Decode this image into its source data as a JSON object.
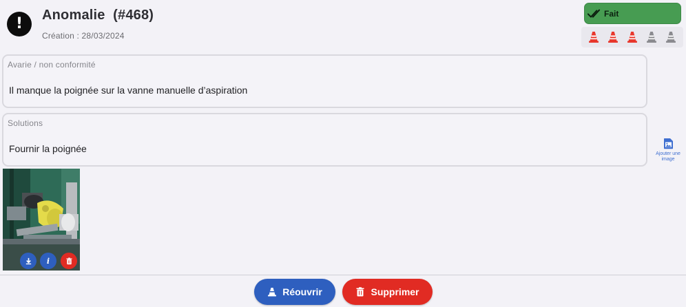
{
  "header": {
    "title": "Anomalie  (#468)",
    "creation": "Création : 28/03/2024",
    "alert_icon": "!",
    "alert_icon_name": "exclamation-circle-icon"
  },
  "status": {
    "label": "Fait",
    "icon": "double-check-icon",
    "color": "#479c52"
  },
  "priority": {
    "active_count": 3,
    "total": 5,
    "active_color": "#e8372c",
    "inactive_color": "#8a8a8f",
    "icon": "traffic-cone-icon"
  },
  "fields": {
    "damage": {
      "label": "Avarie / non conformité",
      "value": "Il manque la poignée sur la vanne manuelle d’aspiration"
    },
    "solutions": {
      "label": "Solutions",
      "value": "Fournir la poignée"
    }
  },
  "add_image": {
    "label_line1": "Ajouter une",
    "label_line2": "image",
    "icon": "add-image-icon"
  },
  "photo": {
    "download_icon": "download-icon",
    "info_icon": "info-icon",
    "delete_icon": "trash-icon",
    "info_glyph": "i"
  },
  "actions": {
    "reopen_label": "Réouvrir",
    "reopen_color": "#2e5fbf",
    "delete_label": "Supprimer",
    "delete_color": "#e12b23"
  }
}
